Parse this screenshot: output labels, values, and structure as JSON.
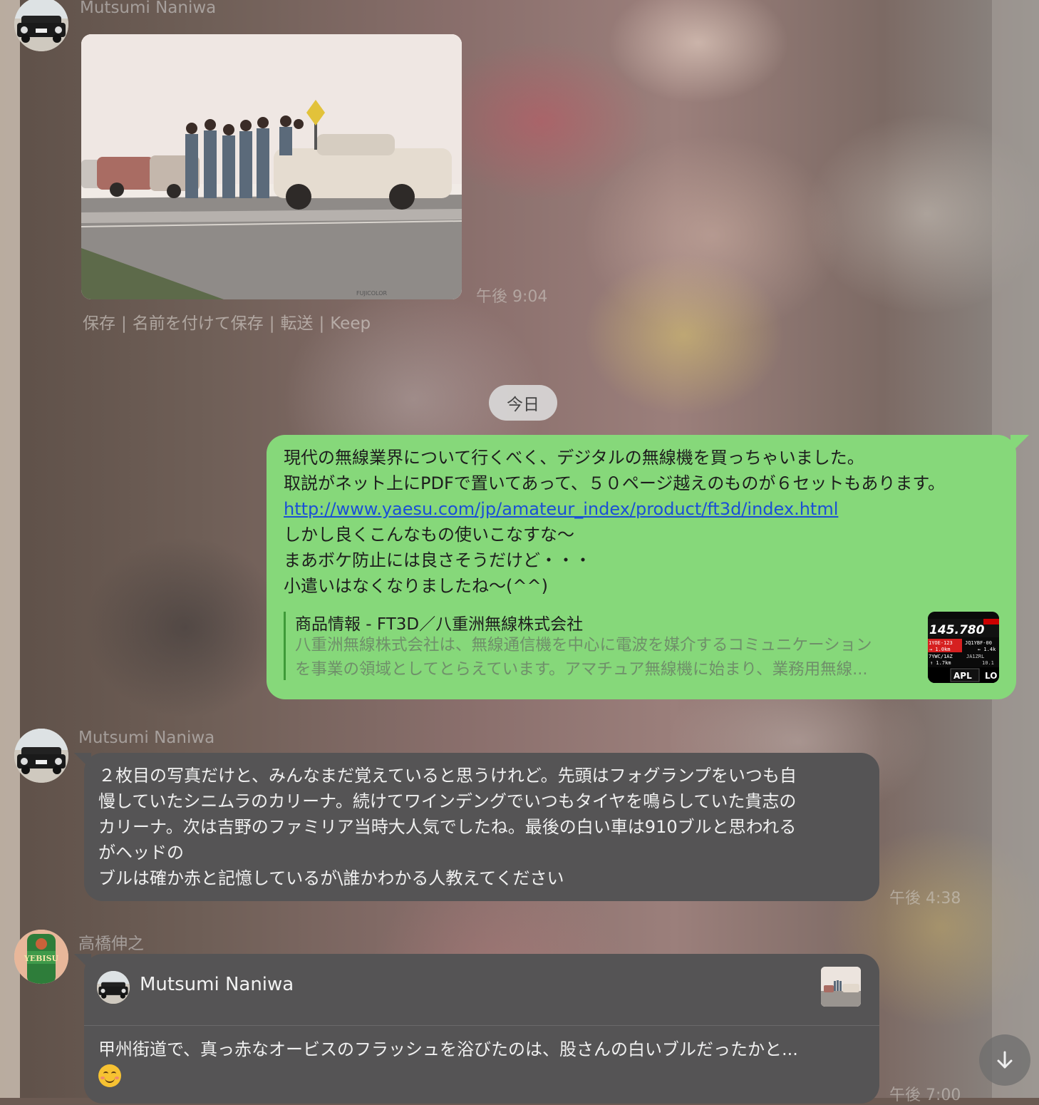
{
  "chat": {
    "messages": [
      {
        "sender": "Mutsumi Naniwa",
        "type": "photo",
        "photo_stamp": "FUJICOLOR",
        "actions": [
          "保存",
          "名前を付けて保存",
          "転送",
          "Keep"
        ],
        "time": "午後 9:04"
      }
    ],
    "date_divider": "今日",
    "outgoing": {
      "lines": [
        "現代の無線業界について行くべく、デジタルの無線機を買っちゃいました。",
        "取説がネット上にPDFで置いてあって、５０ページ越えのものが６セットもあります。"
      ],
      "link": "http://www.yaesu.com/jp/amateur_index/product/ft3d/index.html",
      "lines_after": [
        "しかし良くこんなもの使いこなすな〜",
        "まあボケ防止には良さそうだけど・・・",
        "小遣いはなくなりましたね〜(^^)"
      ],
      "preview": {
        "title": "商品情報 - FT3D／八重洲無線株式会社",
        "desc_line1": "八重洲無線株式会社は、無線通信機を中心に電波を媒介するコミュニケーション",
        "desc_line2": "を事業の領域としてとらえています。アマチュア無線機に始まり、業務用無線...",
        "thumb_freq": "145.780",
        "thumb_rows": [
          "1YOE-123",
          "JQ1YBF-00",
          "→ 1.0km",
          "← 1.4k",
          "7YWC/1AZ",
          "JA1ZRL",
          "↑ 1.7km",
          "10.1"
        ],
        "thumb_buttons": [
          "APL",
          "LO"
        ]
      }
    },
    "incoming_1": {
      "sender": "Mutsumi Naniwa",
      "lines": [
        "２枚目の写真だけと、みんなまだ覚えていると思うけれど。先頭はフォグランプをいつも自",
        "慢していたシニムラのカリーナ。続けてワインデングでいつもタイヤを鳴らしていた貴志の",
        "カリーナ。次は吉野のファミリア当時大人気でしたね。最後の白い車は910ブルと思われる",
        "がヘッドの",
        "ブルは確か赤と記憶しているが\\誰かわかる人教えてください"
      ],
      "time": "午後 4:38"
    },
    "incoming_2": {
      "sender": "高橋伸之",
      "reply_to": "Mutsumi Naniwa",
      "text": "甲州街道で、真っ赤なオービスのフラッシュを浴びたのは、股さんの白いブルだったかと...",
      "emoji": "smiling-face-emoji",
      "time": "午後 7:00"
    },
    "avatar_label": "YEBISU"
  },
  "colors": {
    "outgoing_bubble": "#86d87a",
    "incoming_bubble": "#555455",
    "link": "#1a4fd6"
  },
  "icons": {
    "scroll_down": "arrow-down-icon"
  }
}
